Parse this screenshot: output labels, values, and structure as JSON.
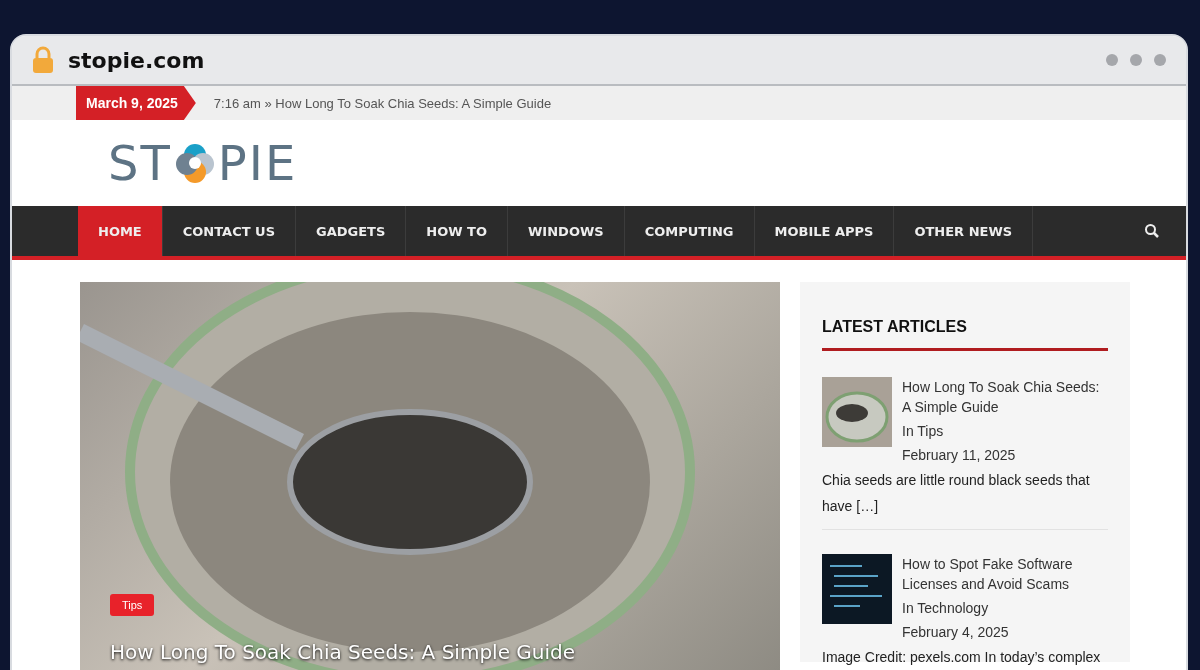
{
  "browser": {
    "address": "stopie.com"
  },
  "ticker": {
    "date": "March 9, 2025",
    "time": "7:16 am",
    "separator": "»",
    "headline": "How Long To Soak Chia Seeds: A Simple Guide"
  },
  "logo": {
    "text_before": "ST",
    "text_after": "PIE"
  },
  "nav": {
    "items": [
      {
        "label": "HOME",
        "selected": true
      },
      {
        "label": "CONTACT US",
        "selected": false
      },
      {
        "label": "GADGETS",
        "selected": false
      },
      {
        "label": "HOW TO",
        "selected": false
      },
      {
        "label": "WINDOWS",
        "selected": false
      },
      {
        "label": "COMPUTING",
        "selected": false
      },
      {
        "label": "MOBILE APPS",
        "selected": false
      },
      {
        "label": "OTHER NEWS",
        "selected": false
      }
    ]
  },
  "featured": {
    "category": "Tips",
    "title": "How Long To Soak Chia Seeds: A Simple Guide"
  },
  "sidebar": {
    "title": "LATEST ARTICLES",
    "articles": [
      {
        "kind": "jar",
        "title": "How Long To Soak Chia Seeds: A Simple Guide",
        "category": "In Tips",
        "date": "February 11, 2025",
        "excerpt": "Chia seeds are little round black seeds that have […]"
      },
      {
        "kind": "code",
        "title": "How to Spot Fake Software Licenses and Avoid Scams",
        "category": "In Technology",
        "date": "February 4, 2025",
        "excerpt": "Image Credit: pexels.com In today’s complex"
      }
    ]
  }
}
